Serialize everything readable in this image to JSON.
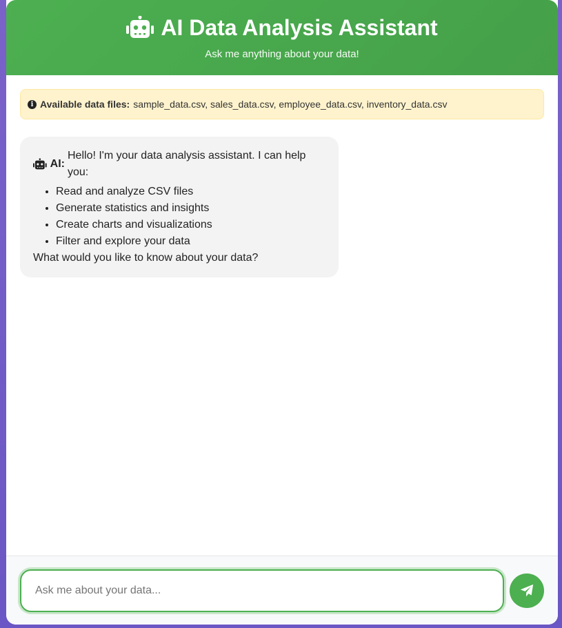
{
  "header": {
    "title": "AI Data Analysis Assistant",
    "subtitle": "Ask me anything about your data!",
    "icon": "robot-icon"
  },
  "info": {
    "label": "Available data files:",
    "files": "sample_data.csv, sales_data.csv, employee_data.csv, inventory_data.csv",
    "icon": "info-icon"
  },
  "messages": [
    {
      "sender": "AI:",
      "intro": "Hello! I'm your data analysis assistant. I can help you:",
      "items": [
        "Read and analyze CSV files",
        "Generate statistics and insights",
        "Create charts and visualizations",
        "Filter and explore your data"
      ],
      "outro": "What would you like to know about your data?"
    }
  ],
  "input": {
    "placeholder": "Ask me about your data...",
    "value": ""
  },
  "colors": {
    "accent": "#4caf50",
    "info_bg": "#fff3cd",
    "bubble_bg": "#f3f3f3"
  }
}
